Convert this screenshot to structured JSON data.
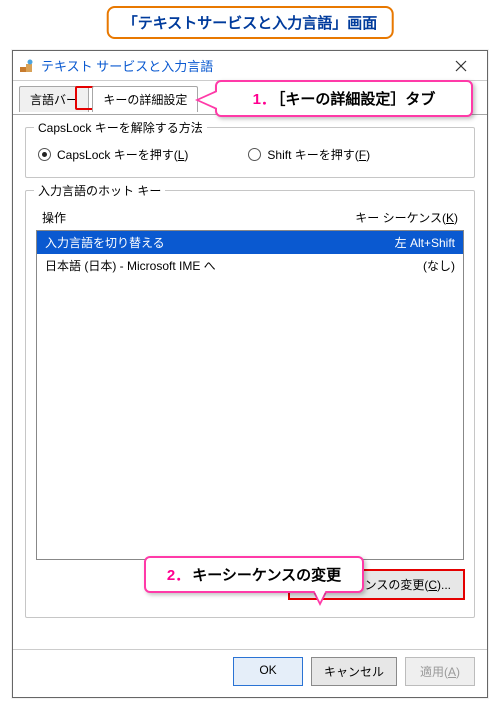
{
  "banner": {
    "text": "「テキストサービスと入力言語」画面"
  },
  "callouts": {
    "c1": {
      "lead": "1．",
      "text": "［キーの詳細設定］タブ"
    },
    "c2": {
      "lead": "2．",
      "text": "キーシーケンスの変更"
    }
  },
  "window": {
    "title": "テキスト サービスと入力言語",
    "close_icon_name": "close-icon"
  },
  "tabs": {
    "tab1": "言語バー",
    "tab2": "キーの詳細設定"
  },
  "caps_group": {
    "legend": "CapsLock キーを解除する方法",
    "radio1_label": "CapsLock キーを押す(",
    "radio1_hotkey": "L",
    "radio1_suffix": ")",
    "radio2_label": "Shift キーを押す(",
    "radio2_hotkey": "F",
    "radio2_suffix": ")"
  },
  "hotkey_group": {
    "legend": "入力言語のホット キー",
    "col_op": "操作",
    "col_seq_label": "キー シーケンス(",
    "col_seq_hotkey": "K",
    "col_seq_suffix": ")",
    "rows": [
      {
        "op": "入力言語を切り替える",
        "seq": "左 Alt+Shift"
      },
      {
        "op": "日本語 (日本) - Microsoft IME へ",
        "seq": "(なし)"
      }
    ],
    "change_btn_label": "キー シーケンスの変更(",
    "change_btn_hotkey": "C",
    "change_btn_suffix": ")..."
  },
  "buttons": {
    "ok": "OK",
    "cancel": "キャンセル",
    "apply_label": "適用(",
    "apply_hotkey": "A",
    "apply_suffix": ")"
  }
}
